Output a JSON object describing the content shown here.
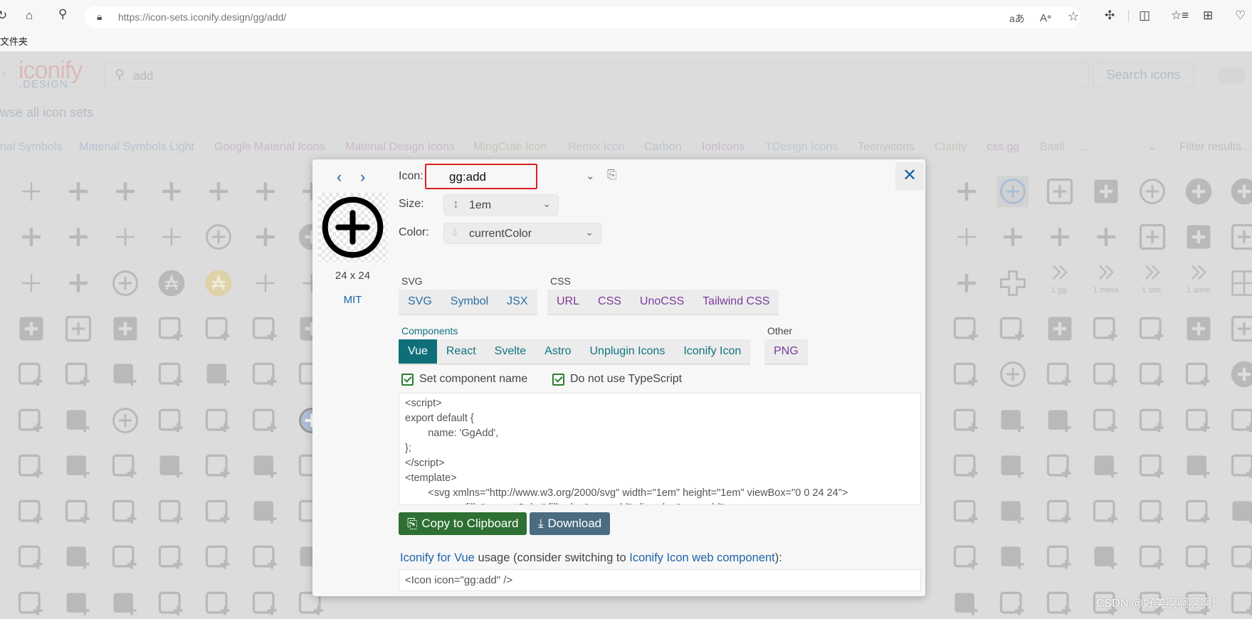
{
  "browser": {
    "url_host": "https://icon-sets.iconify.design",
    "url_path": "/gg/add/",
    "bookmark_folder": "文件夹",
    "toolbar_icons": [
      "refresh-icon",
      "home-icon",
      "search-icon",
      "lock-icon",
      "translate-icon",
      "read-aloud-icon",
      "favorite-star-icon",
      "extensions-icon",
      "split-screen-icon",
      "favorites-icon",
      "collections-icon",
      "browser-essentials-icon"
    ]
  },
  "site": {
    "logo_top": "iconify",
    "logo_bottom": ".DESIGN",
    "search_value": "add",
    "search_button": "Search icons",
    "browse_link": "wse all icon sets",
    "icon_set_tabs": [
      {
        "label": "rial Symbols",
        "color": "#b8c2cc"
      },
      {
        "label": "Material Symbols Light",
        "color": "#b8c0d2"
      },
      {
        "label": "Google Material Icons",
        "color": "#c6b8cc"
      },
      {
        "label": "Material Design Icons",
        "color": "#ccb8cc"
      },
      {
        "label": "MingCute Icon",
        "color": "#c0c8b8"
      },
      {
        "label": "Remix Icon",
        "color": "#c2c6cc"
      },
      {
        "label": "Carbon",
        "color": "#bcc4cc"
      },
      {
        "label": "IonIcons",
        "color": "#c8b8cc"
      },
      {
        "label": "TDesign Icons",
        "color": "#bcc6d2"
      },
      {
        "label": "Teenyicons",
        "color": "#c2c2c2"
      },
      {
        "label": "Clarity",
        "color": "#c4c8b8"
      },
      {
        "label": "css.gg",
        "color": "#c8b8cc"
      },
      {
        "label": "Basil",
        "color": "#c2c6c2"
      },
      {
        "label": "...",
        "color": "#c2c2c2"
      }
    ],
    "filter_placeholder": "Filter results...",
    "icon_grid": {
      "left": [
        [
          "plus-thin",
          "plus",
          "plus",
          "plus",
          "plus",
          "plus",
          "plus"
        ],
        [
          "plus",
          "plus",
          "plus-thin",
          "plus-thin",
          "plus-circle",
          "plus",
          "plus-circle-filled"
        ],
        [
          "plus-thin",
          "plus",
          "plus-circle",
          "accessibility-filled",
          "accessibility-yellow",
          "plus-thin",
          "plus-thin"
        ],
        [
          "plus-square-filled",
          "plus-square",
          "plus-square-filled",
          "image-plus",
          "image-plus",
          "image-plus",
          "plus-square-filled"
        ],
        [
          "bucket-plus",
          "mic-plus",
          "bag-plus-filled",
          "bag-plus",
          "bag-plus-filled",
          "map-plus",
          "box-plus"
        ],
        [
          "browser-plus",
          "list-plus-filled",
          "plus-circle",
          "image-plus",
          "browser-plus",
          "list-plus",
          "plus-circle-blue"
        ],
        [
          "cake-plus",
          "cake-plus-filled",
          "wifi-plus",
          "file-plus-filled",
          "file-plus",
          "file-plus-filled",
          "note-plus"
        ],
        [
          "note-plus",
          "note-plus",
          "wifi-plus",
          "wifi-plus",
          "card-plus",
          "home-plus-filled",
          "link-plus"
        ],
        [
          "card-plus",
          "home-plus-filled",
          "link-plus",
          "columns-plus",
          "check-plus",
          "wifi-plus",
          "file-plus-filled"
        ],
        [
          "leaf-plus",
          "hexagon-plus-filled",
          "hexagon-plus-filled",
          "hexagon-plus",
          "hexagon-plus",
          "hexagon-plus",
          "hexagon-plus"
        ]
      ],
      "right": [
        [
          "plus",
          "plus-circle-selected",
          "plus-square",
          "plus-square-filled",
          "plus-circle",
          "plus-circle-filled",
          "plus-circle-filled"
        ],
        [
          "plus-thin",
          "plus",
          "plus",
          "plus",
          "plus-square",
          "plus-square-filled",
          "plus-square"
        ],
        [
          "plus",
          "plus-outline",
          "chevrons",
          "chevrons",
          "chevrons",
          "chevrons",
          "grid-plus"
        ],
        [
          "map-plus",
          "pencil-plus",
          "plus-square-filled",
          "folder-plus",
          "tag-plus",
          "plus-square-filled",
          "plus-square"
        ],
        [
          "file-plus",
          "plus-circle",
          "image-plus",
          "check-plus",
          "browser-plus",
          "list-plus",
          "plus-circle-filled"
        ],
        [
          "card-plus",
          "card-plus-filled",
          "home-plus-filled",
          "home-plus",
          "link-plus",
          "columns-plus",
          "check-plus"
        ],
        [
          "check-plus",
          "cake-plus-filled",
          "cake-plus",
          "cake-plus-filled",
          "wifi-plus",
          "file-plus-filled",
          "file-plus"
        ],
        [
          "card-plus",
          "home-plus-filled",
          "link-plus",
          "columns-plus",
          "check-plus",
          "wifi-plus",
          "file-plus-filled"
        ],
        [
          "flag-plus",
          "chat-plus-filled",
          "chat-plus",
          "house-plus-filled",
          "link-plus",
          "file-plus",
          "phone-plus"
        ],
        [
          "user-plus-filled",
          "user-plus",
          "smile-plus",
          "box-plus",
          "box-plus",
          "box-plus",
          "box-plus"
        ]
      ],
      "right_labels": [
        "1 gg.",
        "1 mese",
        "1 sett.",
        "1 anno"
      ],
      "icon_color": "#b9b9b9",
      "selected_color": "#a9bfd6"
    },
    "watermark": "CSDN @好美啊啊啊啊！"
  },
  "modal": {
    "icon_label": "Icon:",
    "icon_value": "gg:add",
    "size_label": "Size:",
    "size_value": "1em",
    "color_label": "Color:",
    "color_value": "currentColor",
    "dimensions": "24 x 24",
    "license": "MIT",
    "svg_section": "SVG",
    "svg_tabs": [
      "SVG",
      "Symbol",
      "JSX"
    ],
    "css_section": "CSS",
    "css_tabs": [
      "URL",
      "CSS",
      "UnoCSS",
      "Tailwind CSS"
    ],
    "components_section": "Components",
    "component_tabs": [
      "Vue",
      "React",
      "Svelte",
      "Astro",
      "Unplugin Icons",
      "Iconify Icon"
    ],
    "active_component": "Vue",
    "other_section": "Other",
    "other_tabs": [
      "PNG"
    ],
    "checkbox_component_name": "Set component name",
    "checkbox_no_typescript": "Do not use TypeScript",
    "code_lines": [
      "<script>",
      "export default {",
      "\tname: 'GgAdd',",
      "};",
      "</script>",
      "<template>",
      "\t<svg xmlns=\"http://www.w3.org/2000/svg\" width=\"1em\" height=\"1em\" viewBox=\"0 0 24 24\">",
      "\t\t<g fill=\"currentColor\" fill-rule=\"evenodd\" clip-rule=\"evenodd\">"
    ],
    "copy_button": "Copy to Clipboard",
    "download_button": "Download",
    "usage_link1": "Iconify for Vue",
    "usage_text1": " usage (consider switching to ",
    "usage_link2": "Iconify Icon web component",
    "usage_text2": "):",
    "usage_code": "<Icon icon=\"gg:add\" />",
    "colors": {
      "svg_tab": "#2a6fa8",
      "css_tab": "#7b3a9a",
      "component_tab": "#0f7480",
      "active_bg": "#0e6f79",
      "copy_bg": "#2e7033",
      "download_bg": "#4b6c80",
      "checkbox": "#2e7d32"
    }
  }
}
